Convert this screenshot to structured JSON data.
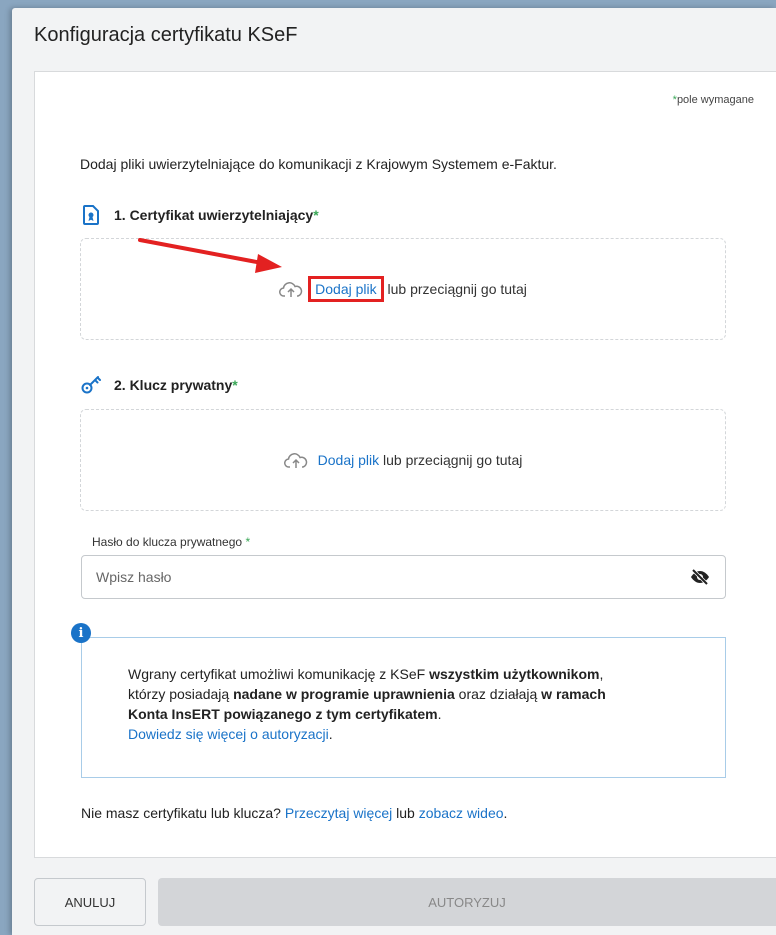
{
  "dialog": {
    "title": "Konfiguracja certyfikatu KSeF"
  },
  "required_note": {
    "star": "*",
    "text": "pole wymagane"
  },
  "intro": "Dodaj pliki uwierzytelniające do komunikacji z Krajowym Systemem e-Faktur.",
  "sections": [
    {
      "label": "1. Certyfikat uwierzytelniający",
      "star": "*",
      "icon": "certificate-file-icon",
      "dropzone": {
        "link": "Dodaj plik",
        "text": "lub przeciągnij go tutaj",
        "icon": "cloud-upload-icon"
      }
    },
    {
      "label": "2. Klucz prywatny",
      "star": "*",
      "icon": "key-icon",
      "dropzone": {
        "link": "Dodaj plik",
        "text": "lub przeciągnij go tutaj",
        "icon": "cloud-upload-icon"
      }
    }
  ],
  "password": {
    "label": "Hasło do klucza prywatnego",
    "star": "*",
    "placeholder": "Wpisz hasło",
    "value": "",
    "toggle_icon": "eye-slash-icon"
  },
  "info": {
    "icon": "info-icon",
    "icon_glyph": "i",
    "line1_pre": "Wgrany certyfikat umożliwi komunikację z KSeF ",
    "line1_bold": "wszystkim użytkownikom",
    "line1_post": ",",
    "line2_pre": "którzy posiadają ",
    "line2_bold1": "nadane w programie uprawnienia",
    "line2_mid": " oraz działają ",
    "line2_bold2": "w ramach",
    "line3_bold": "Konta InsERT powiązanego z tym certyfikatem",
    "line3_post": ".",
    "link": "Dowiedz się więcej o autoryzacji",
    "link_post": "."
  },
  "footer_note": {
    "text": "Nie masz certyfikatu lub klucza? ",
    "link1": "Przeczytaj więcej",
    "mid": " lub ",
    "link2": "zobacz wideo",
    "post": "."
  },
  "buttons": {
    "cancel": "ANULUJ",
    "authorize": "AUTORYZUJ"
  },
  "colors": {
    "accent": "#1a73c8",
    "required": "#3aa757",
    "highlight": "#e32121"
  }
}
